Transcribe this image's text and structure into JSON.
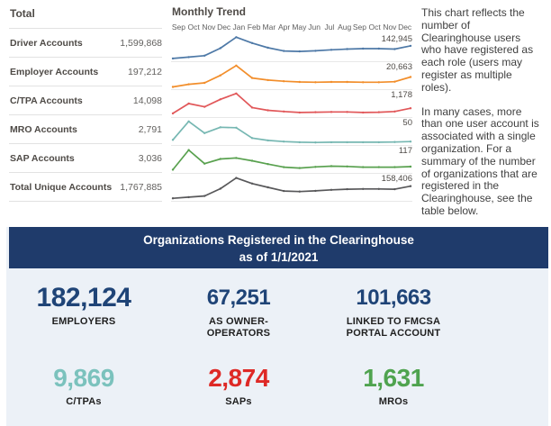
{
  "totals": {
    "title": "Total",
    "rows": [
      {
        "label": "Driver Accounts",
        "value": "1,599,868"
      },
      {
        "label": "Employer Accounts",
        "value": "197,212"
      },
      {
        "label": "C/TPA Accounts",
        "value": "14,098"
      },
      {
        "label": "MRO Accounts",
        "value": "2,791"
      },
      {
        "label": "SAP Accounts",
        "value": "3,036"
      },
      {
        "label": "Total Unique Accounts",
        "value": "1,767,885"
      }
    ]
  },
  "chart_data": {
    "type": "line",
    "title": "Monthly Trend",
    "x": [
      "Sep",
      "Oct",
      "Nov",
      "Dec",
      "Jan",
      "Feb",
      "Mar",
      "Apr",
      "May",
      "Jun",
      "Jul",
      "Aug",
      "Sep",
      "Oct",
      "Nov",
      "Dec"
    ],
    "value_scale": "relative height 0-100 per sparkline row (no y-axis shown); end_label is the labeled final value",
    "legend_position": "none",
    "grid": "row separators only",
    "series": [
      {
        "name": "Driver Accounts",
        "color": "#4E79A7",
        "end_label": "142,945",
        "values": [
          6,
          12,
          18,
          50,
          97,
          72,
          52,
          38,
          36,
          39,
          43,
          46,
          48,
          48,
          46,
          60
        ]
      },
      {
        "name": "Employer Accounts",
        "color": "#F28E2B",
        "end_label": "20,663",
        "values": [
          4,
          15,
          21,
          53,
          95,
          42,
          33,
          28,
          25,
          24,
          25,
          25,
          24,
          24,
          26,
          46
        ]
      },
      {
        "name": "C/TPA Accounts",
        "color": "#E15759",
        "end_label": "1,178",
        "values": [
          10,
          52,
          38,
          70,
          95,
          35,
          23,
          18,
          14,
          15,
          16,
          16,
          14,
          15,
          18,
          32
        ]
      },
      {
        "name": "MRO Accounts",
        "color": "#76B7B2",
        "end_label": "50",
        "values": [
          16,
          95,
          45,
          70,
          68,
          24,
          14,
          9,
          6,
          5,
          6,
          6,
          6,
          6,
          7,
          9
        ]
      },
      {
        "name": "SAP Accounts",
        "color": "#59A14F",
        "end_label": "117",
        "values": [
          8,
          92,
          34,
          54,
          58,
          46,
          32,
          19,
          15,
          20,
          23,
          22,
          19,
          19,
          19,
          21
        ]
      },
      {
        "name": "Total Unique Accounts",
        "color": "#58585a",
        "end_label": "158,406",
        "values": [
          5,
          10,
          15,
          46,
          92,
          68,
          52,
          36,
          34,
          37,
          41,
          44,
          45,
          45,
          44,
          57
        ]
      }
    ]
  },
  "description": {
    "paragraphs": [
      "This chart reflects the number of Clearinghouse users who have registered as each role (users may register as multiple roles).",
      "In many cases, more than one user account is associated with a single organization. For a summary of the number of organizations that are registered in the Clearinghouse, see the table below."
    ]
  },
  "orgs": {
    "banner_line1": "Organizations Registered in the Clearinghouse",
    "banner_line2": "as of 1/1/2021",
    "banner_color": "#1f3b6b",
    "stats": [
      {
        "value": "182,124",
        "label": "EMPLOYERS",
        "color": "#1f4477",
        "size": "xl",
        "row": 1
      },
      {
        "value": "67,251",
        "label": "AS OWNER-OPERATORS",
        "color": "#1f4477",
        "size": "md",
        "row": 1
      },
      {
        "value": "101,663",
        "label": "LINKED TO FMCSA PORTAL ACCOUNT",
        "color": "#1f4477",
        "size": "md",
        "row": 1
      },
      {
        "value": "9,869",
        "label": "C/TPAs",
        "color": "#7bc2bd",
        "size": "lg",
        "row": 2
      },
      {
        "value": "2,874",
        "label": "SAPs",
        "color": "#de2926",
        "size": "lg",
        "row": 2
      },
      {
        "value": "1,631",
        "label": "MROs",
        "color": "#4fa34f",
        "size": "lg",
        "row": 2
      }
    ]
  }
}
